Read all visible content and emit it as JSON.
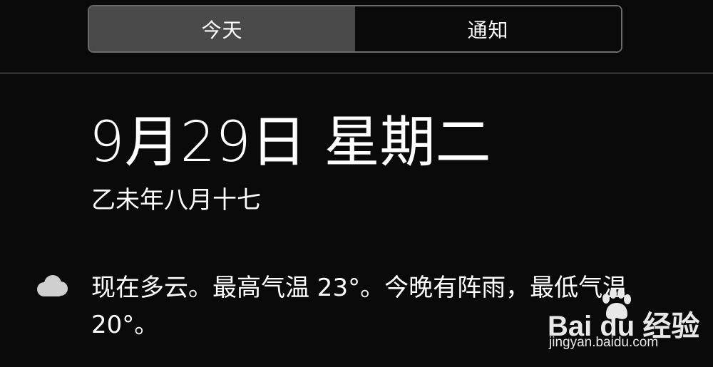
{
  "tabs": {
    "today_label": "今天",
    "notifications_label": "通知",
    "selected": "today"
  },
  "header": {
    "date": "9月29日 星期二",
    "lunar_date": "乙未年八月十七"
  },
  "weather": {
    "icon": "cloud-icon",
    "summary": "现在多云。最高气温 23°。今晚有阵雨，最低气温 20°。"
  },
  "watermark": {
    "logo": "Bai du 经验",
    "url": "jingyan.baidu.com"
  },
  "colors": {
    "background": "#0a0a0a",
    "segment_active": "#4a4a4a",
    "segment_border": "#6b6b6b",
    "text": "#ffffff"
  }
}
